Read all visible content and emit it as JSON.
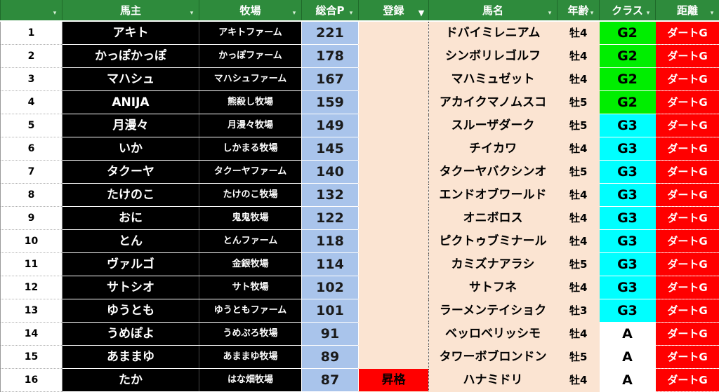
{
  "headers": [
    {
      "label": "",
      "filter_icon": "filter-icon",
      "active": false
    },
    {
      "label": "馬主",
      "filter_icon": "filter-icon",
      "active": false
    },
    {
      "label": "牧場",
      "filter_icon": "filter-icon",
      "active": false
    },
    {
      "label": "総合P",
      "filter_icon": "filter-icon",
      "active": false
    },
    {
      "label": "登録",
      "filter_icon": "filter-active-icon",
      "active": true
    },
    {
      "label": "馬名",
      "filter_icon": "filter-icon",
      "active": false
    },
    {
      "label": "年齢",
      "filter_icon": "filter-icon",
      "active": false
    },
    {
      "label": "クラス",
      "filter_icon": "filter-icon",
      "active": false
    },
    {
      "label": "距離",
      "filter_icon": "filter-icon",
      "active": false
    }
  ],
  "filter_glyphs": {
    "normal": "▾",
    "active": "▼"
  },
  "class_colors": {
    "G2": "#00ee00",
    "G3": "#00ffff",
    "A": "#ffffff"
  },
  "colors": {
    "header_bg": "#2e8b3c",
    "points_bg": "#a9c4eb",
    "peach_bg": "#fbe4d2",
    "distance_bg": "#ff0000",
    "register_highlight": "#ff0000"
  },
  "rows": [
    {
      "no": "1",
      "owner": "アキト",
      "farm": "アキトファーム",
      "points": "221",
      "register": "",
      "horse": "ドバイミレニアム",
      "age": "牡4",
      "class": "G2",
      "distance": "ダートG"
    },
    {
      "no": "2",
      "owner": "かっぽかっぽ",
      "farm": "かっぽファーム",
      "points": "178",
      "register": "",
      "horse": "シンボリレゴルフ",
      "age": "牡4",
      "class": "G2",
      "distance": "ダートG"
    },
    {
      "no": "3",
      "owner": "マハシュ",
      "farm": "マハシュファーム",
      "points": "167",
      "register": "",
      "horse": "マハミュゼット",
      "age": "牡4",
      "class": "G2",
      "distance": "ダートG"
    },
    {
      "no": "4",
      "owner": "ANIJA",
      "farm": "熊殺し牧場",
      "points": "159",
      "register": "",
      "horse": "アカイクマノムスコ",
      "age": "牡5",
      "class": "G2",
      "distance": "ダートG"
    },
    {
      "no": "5",
      "owner": "月漫々",
      "farm": "月漫々牧場",
      "points": "149",
      "register": "",
      "horse": "スルーザダーク",
      "age": "牡5",
      "class": "G3",
      "distance": "ダートG"
    },
    {
      "no": "6",
      "owner": "いか",
      "farm": "しかまる牧場",
      "points": "145",
      "register": "",
      "horse": "チイカワ",
      "age": "牡4",
      "class": "G3",
      "distance": "ダートG"
    },
    {
      "no": "7",
      "owner": "タクーヤ",
      "farm": "タクーヤファーム",
      "points": "140",
      "register": "",
      "horse": "タクーヤバクシンオ",
      "age": "牡5",
      "class": "G3",
      "distance": "ダートG"
    },
    {
      "no": "8",
      "owner": "たけのこ",
      "farm": "たけのこ牧場",
      "points": "132",
      "register": "",
      "horse": "エンドオブワールド",
      "age": "牡4",
      "class": "G3",
      "distance": "ダートG"
    },
    {
      "no": "9",
      "owner": "おに",
      "farm": "鬼鬼牧場",
      "points": "122",
      "register": "",
      "horse": "オニボロス",
      "age": "牡4",
      "class": "G3",
      "distance": "ダートG"
    },
    {
      "no": "10",
      "owner": "とん",
      "farm": "とんファーム",
      "points": "118",
      "register": "",
      "horse": "ピクトゥブミナール",
      "age": "牡4",
      "class": "G3",
      "distance": "ダートG"
    },
    {
      "no": "11",
      "owner": "ヴァルゴ",
      "farm": "金銀牧場",
      "points": "114",
      "register": "",
      "horse": "カミズナアラシ",
      "age": "牡5",
      "class": "G3",
      "distance": "ダートG"
    },
    {
      "no": "12",
      "owner": "サトシオ",
      "farm": "サト牧場",
      "points": "102",
      "register": "",
      "horse": "サトフネ",
      "age": "牡4",
      "class": "G3",
      "distance": "ダートG"
    },
    {
      "no": "13",
      "owner": "ゆうとも",
      "farm": "ゆうともファーム",
      "points": "101",
      "register": "",
      "horse": "ラーメンテイショク",
      "age": "牡3",
      "class": "G3",
      "distance": "ダートG"
    },
    {
      "no": "14",
      "owner": "うめぽよ",
      "farm": "うめぷろ牧場",
      "points": "91",
      "register": "",
      "horse": "ベッロベリッシモ",
      "age": "牡4",
      "class": "A",
      "distance": "ダートG"
    },
    {
      "no": "15",
      "owner": "あままゆ",
      "farm": "あままゆ牧場",
      "points": "89",
      "register": "",
      "horse": "タワーボブロンドン",
      "age": "牡5",
      "class": "A",
      "distance": "ダートG"
    },
    {
      "no": "16",
      "owner": "たか",
      "farm": "はな畑牧場",
      "points": "87",
      "register": "昇格",
      "horse": "ハナミドリ",
      "age": "牡4",
      "class": "A",
      "distance": "ダートG"
    }
  ]
}
